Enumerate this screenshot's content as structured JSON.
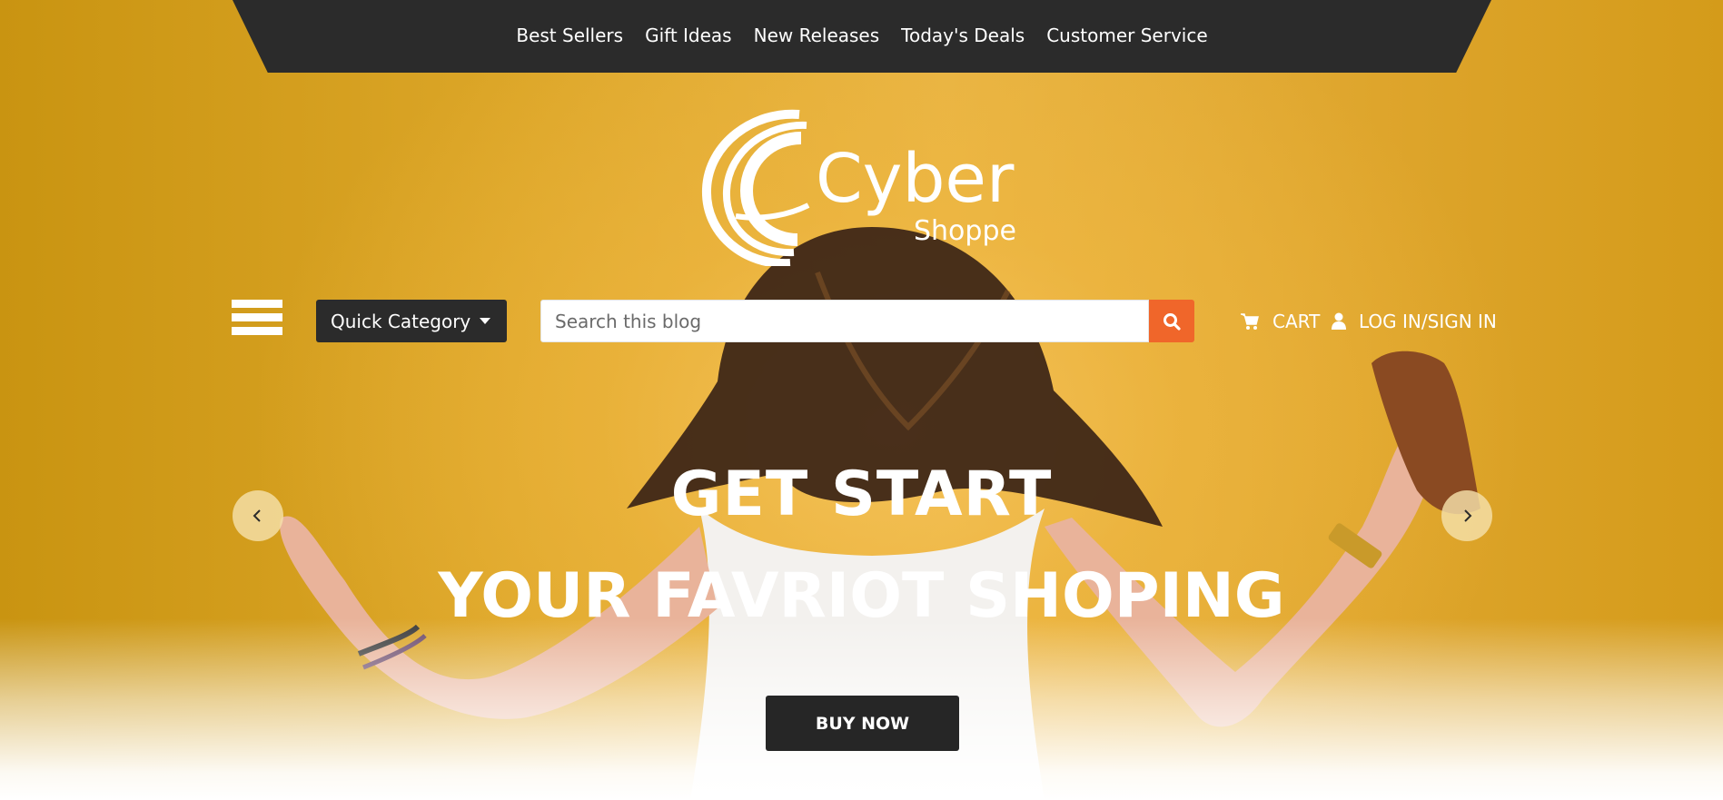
{
  "top_nav": {
    "items": [
      "Best Sellers",
      "Gift Ideas",
      "New Releases",
      "Today's Deals",
      "Customer Service"
    ]
  },
  "logo": {
    "name": "Cyber",
    "sub": "Shoppe"
  },
  "toolbar": {
    "menu_icon": "hamburger-menu-icon",
    "quick_category_label": "Quick Category",
    "search_placeholder": "Search this blog",
    "search_icon": "search-icon",
    "cart_label": "CART",
    "cart_icon": "cart-icon",
    "login_label": "LOG IN/SIGN IN",
    "user_icon": "user-icon"
  },
  "hero": {
    "line1": "GET START",
    "line2": "YOUR FAVRIOT SHOPING",
    "button_label": "BUY NOW",
    "prev_icon": "chevron-left-icon",
    "next_icon": "chevron-right-icon"
  },
  "colors": {
    "nav_bg": "#2b2b2b",
    "accent_orange": "#f0662a",
    "hero_yellow": "#dca628",
    "button_dark": "#262626",
    "text_light": "#ffffff"
  }
}
